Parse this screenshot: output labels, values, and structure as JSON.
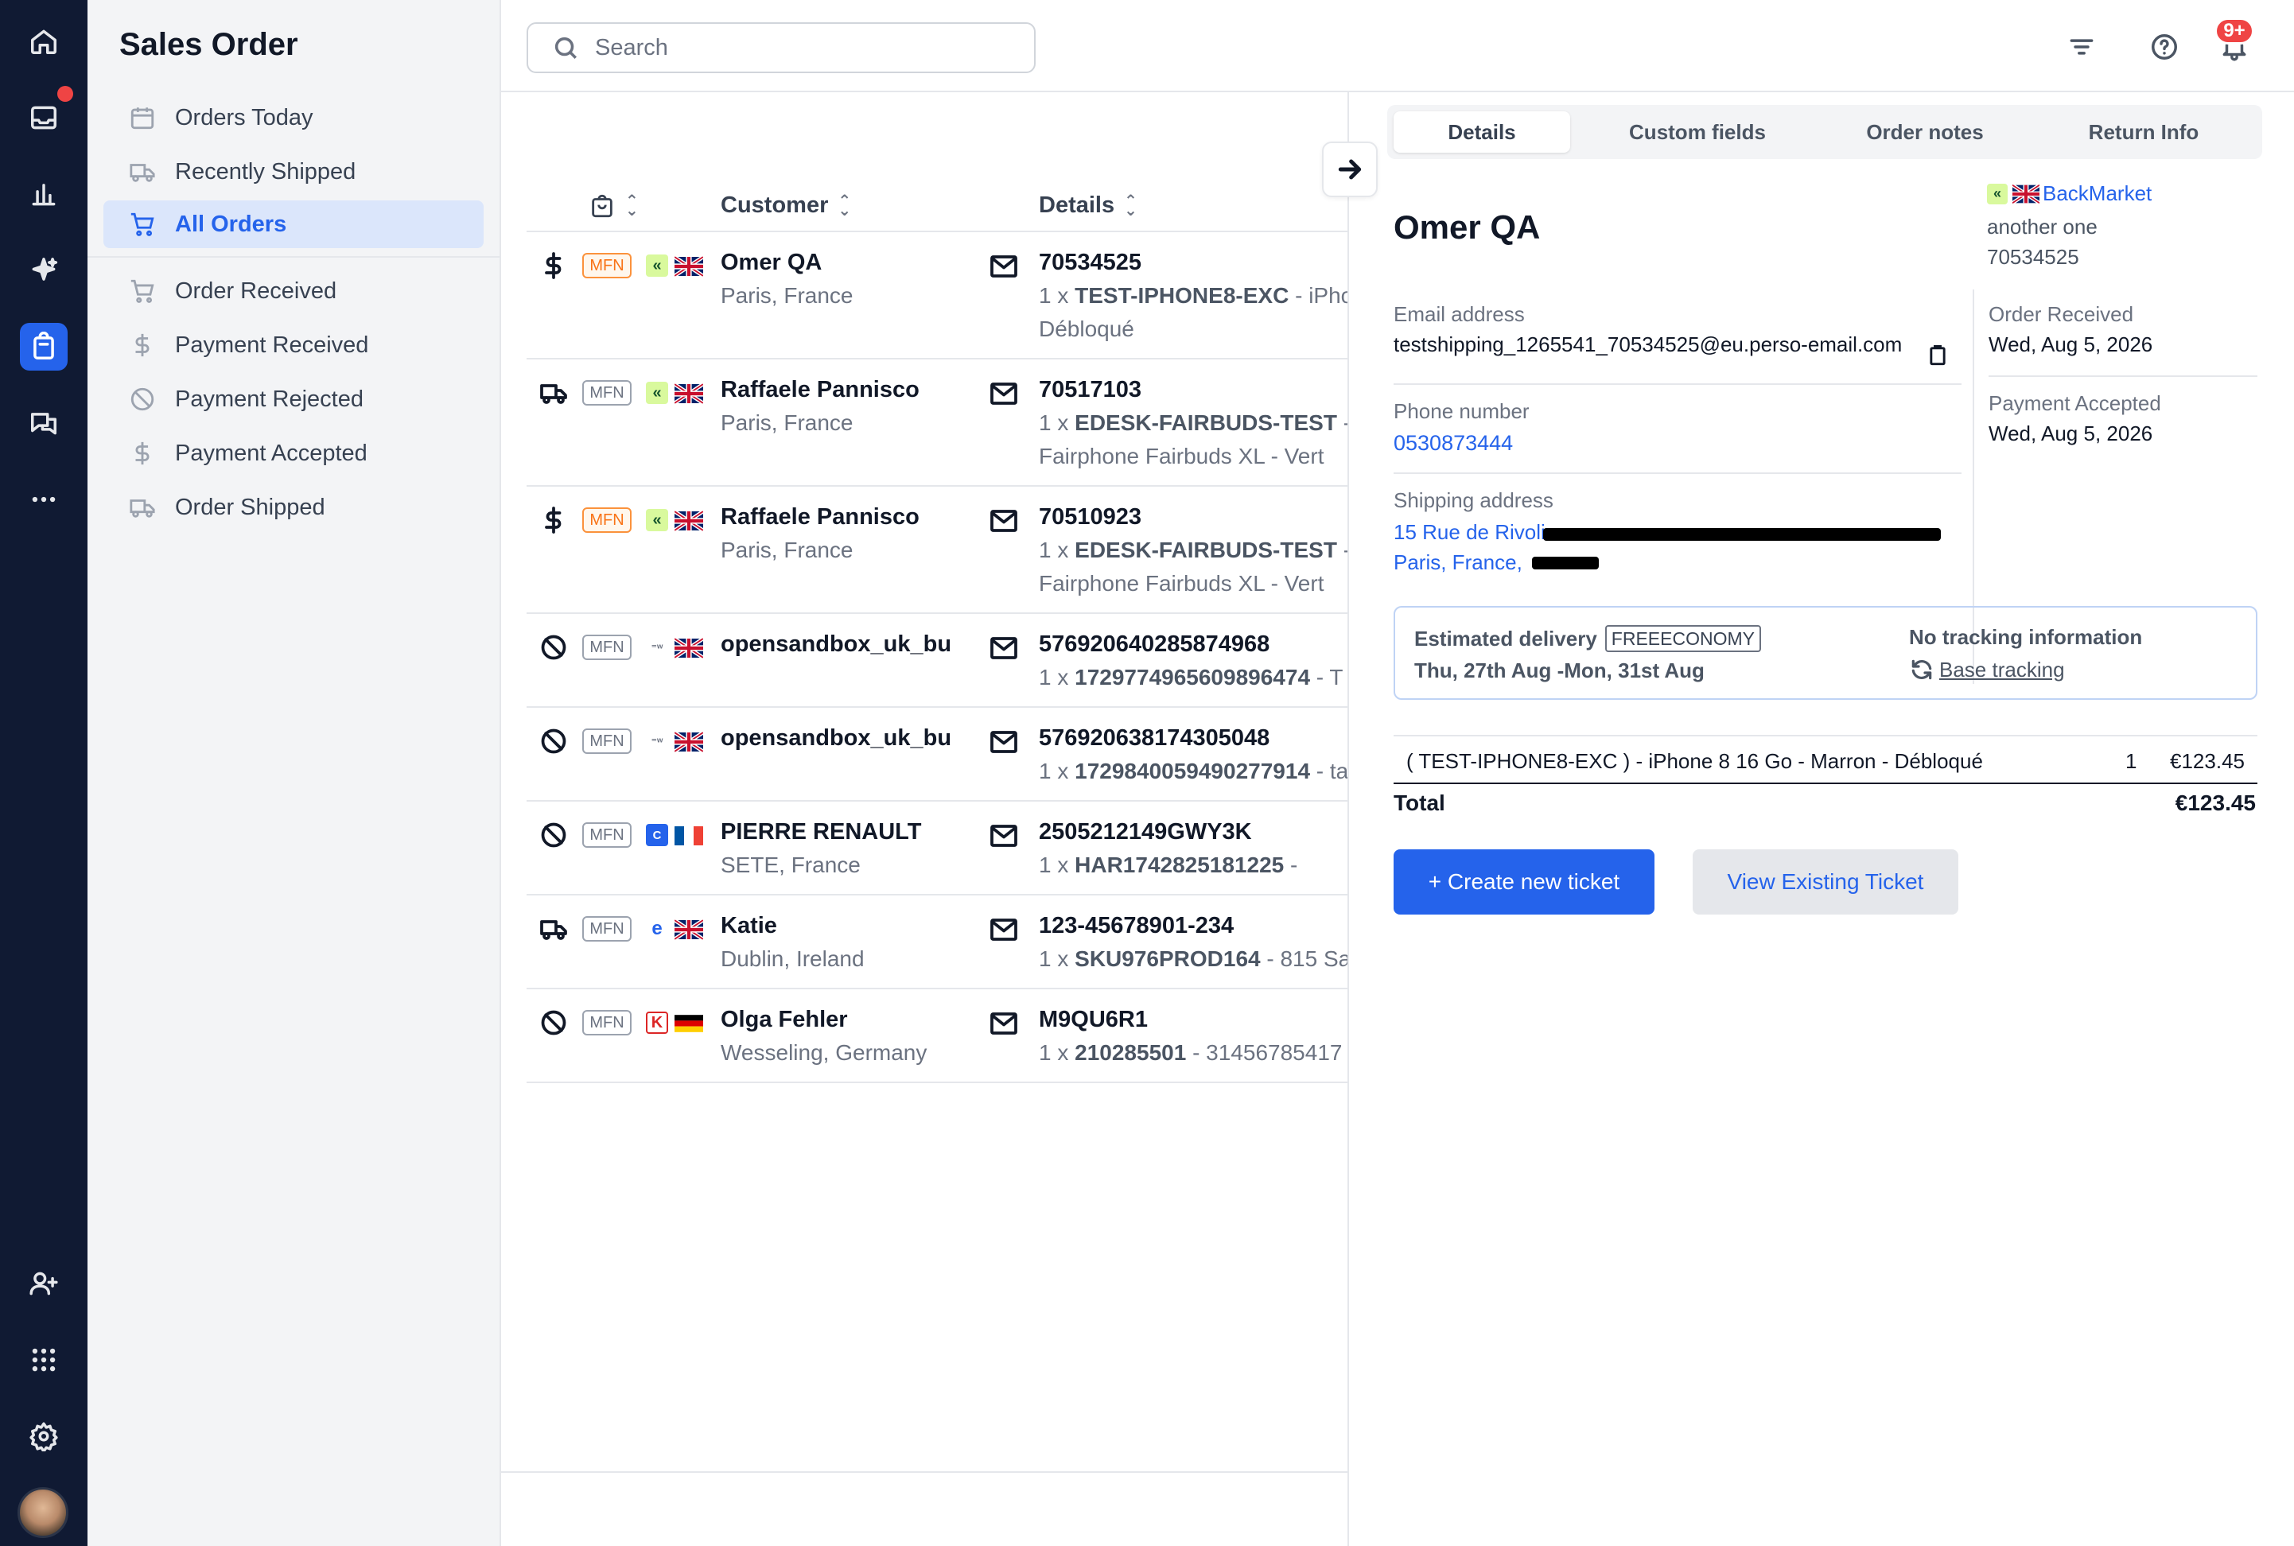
{
  "app": {
    "title": "Sales Order",
    "notifications_badge": "9+"
  },
  "rail": {
    "icons": [
      "home-icon",
      "inbox-icon",
      "analytics-icon",
      "sparkle-icon",
      "orders-icon",
      "conversations-icon",
      "more-icon",
      "add-user-icon",
      "apps-grid-icon",
      "settings-icon"
    ],
    "active": "orders-icon",
    "accent": "#2563eb"
  },
  "sidebar": {
    "items": [
      {
        "label": "Orders Today",
        "icon": "calendar-icon"
      },
      {
        "label": "Recently Shipped",
        "icon": "truck-icon"
      },
      {
        "label": "All Orders",
        "icon": "cart-icon",
        "active": true
      },
      {
        "label": "Order Received",
        "icon": "cart-icon"
      },
      {
        "label": "Payment Received",
        "icon": "dollar-icon"
      },
      {
        "label": "Payment Rejected",
        "icon": "ban-icon"
      },
      {
        "label": "Payment Accepted",
        "icon": "dollar-icon"
      },
      {
        "label": "Order Shipped",
        "icon": "truck-icon"
      }
    ]
  },
  "search": {
    "placeholder": "Search"
  },
  "list": {
    "headers": {
      "customer": "Customer",
      "details": "Details"
    },
    "rows": [
      {
        "status_icon": "dollar-icon",
        "tag": "MFN",
        "tag_style": "orange",
        "marketplace": "backmarket",
        "flag": "uk",
        "customer": "Omer QA",
        "location": "Paris, France",
        "order_id": "70534525",
        "qty": "1 x",
        "sku": "TEST-IPHONE8-EXC",
        "desc": " - iPhor",
        "desc2": "Débloqué"
      },
      {
        "status_icon": "truck-icon",
        "tag": "MFN",
        "tag_style": "grey",
        "marketplace": "backmarket",
        "flag": "uk",
        "customer": "Raffaele Pannisco",
        "location": "Paris, France",
        "order_id": "70517103",
        "qty": "1 x",
        "sku": "EDESK-FAIRBUDS-TEST",
        "desc": " - C",
        "desc2": "Fairphone Fairbuds XL - Vert"
      },
      {
        "status_icon": "dollar-icon",
        "tag": "MFN",
        "tag_style": "orange",
        "marketplace": "backmarket",
        "flag": "uk",
        "customer": "Raffaele Pannisco",
        "location": "Paris, France",
        "order_id": "70510923",
        "qty": "1 x",
        "sku": "EDESK-FAIRBUDS-TEST",
        "desc": " - C",
        "desc2": "Fairphone Fairbuds XL - Vert"
      },
      {
        "status_icon": "ban-icon",
        "tag": "MFN",
        "tag_style": "grey",
        "marketplace": "onbuy",
        "flag": "uk",
        "customer": "opensandbox_uk_bu",
        "location": "",
        "order_id": "576920640285874968",
        "qty": "1 x",
        "sku": "1729774965609896474",
        "desc": " - T",
        "desc2": ""
      },
      {
        "status_icon": "ban-icon",
        "tag": "MFN",
        "tag_style": "grey",
        "marketplace": "onbuy",
        "flag": "uk",
        "customer": "opensandbox_uk_bu",
        "location": "",
        "order_id": "576920638174305048",
        "qty": "1 x",
        "sku": "1729840059490277914",
        "desc": " - ta",
        "desc2": ""
      },
      {
        "status_icon": "ban-icon",
        "tag": "MFN",
        "tag_style": "grey",
        "marketplace": "cdiscount",
        "flag": "fr",
        "customer": "PIERRE RENAULT",
        "location": "SETE, France",
        "order_id": "2505212149GWY3K",
        "qty": "1 x",
        "sku": "HAR1742825181225",
        "desc": " -",
        "desc2": ""
      },
      {
        "status_icon": "truck-icon",
        "tag": "MFN",
        "tag_style": "grey",
        "marketplace": "ebay",
        "flag": "uk",
        "customer": "Katie",
        "location": "Dublin, Ireland",
        "order_id": "123-45678901-234",
        "qty": "1 x",
        "sku": "SKU976PROD164",
        "desc": " - 815 Sam",
        "desc2": ""
      },
      {
        "status_icon": "ban-icon",
        "tag": "MFN",
        "tag_style": "grey",
        "marketplace": "kaufland",
        "flag": "de",
        "customer": "Olga Fehler",
        "location": "Wesseling, Germany",
        "order_id": "M9QU6R1",
        "qty": "1 x",
        "sku": "210285501",
        "desc": " - 31456785417",
        "desc2": ""
      }
    ]
  },
  "detail": {
    "tabs": [
      "Details",
      "Custom fields",
      "Order notes",
      "Return Info"
    ],
    "active_tab": "Details",
    "customer_name": "Omer QA",
    "channel": "BackMarket",
    "channel_sub": "another one",
    "order_id": "70534525",
    "email_label": "Email address",
    "email": "testshipping_1265541_70534525@eu.perso-email.com",
    "phone_label": "Phone number",
    "phone": "0530873444",
    "shipping_label": "Shipping address",
    "address_line1": "15 Rue de Rivoli",
    "address_line2": "Paris, France,",
    "order_received_label": "Order Received",
    "order_received_date": "Wed, Aug 5, 2026",
    "payment_accepted_label": "Payment Accepted",
    "payment_accepted_date": "Wed, Aug 5, 2026",
    "delivery_label": "Estimated delivery",
    "delivery_service": "FREEECONOMY",
    "delivery_dates": "Thu, 27th Aug -Mon, 31st Aug",
    "tracking_title": "No tracking information",
    "tracking_link": "Base tracking",
    "item_desc": "( TEST-IPHONE8-EXC ) - iPhone 8 16 Go - Marron - Débloqué",
    "item_qty": "1",
    "item_price": "€123.45",
    "total_label": "Total",
    "total_value": "€123.45",
    "create_ticket": "+ Create new ticket",
    "view_ticket": "View Existing Ticket"
  }
}
